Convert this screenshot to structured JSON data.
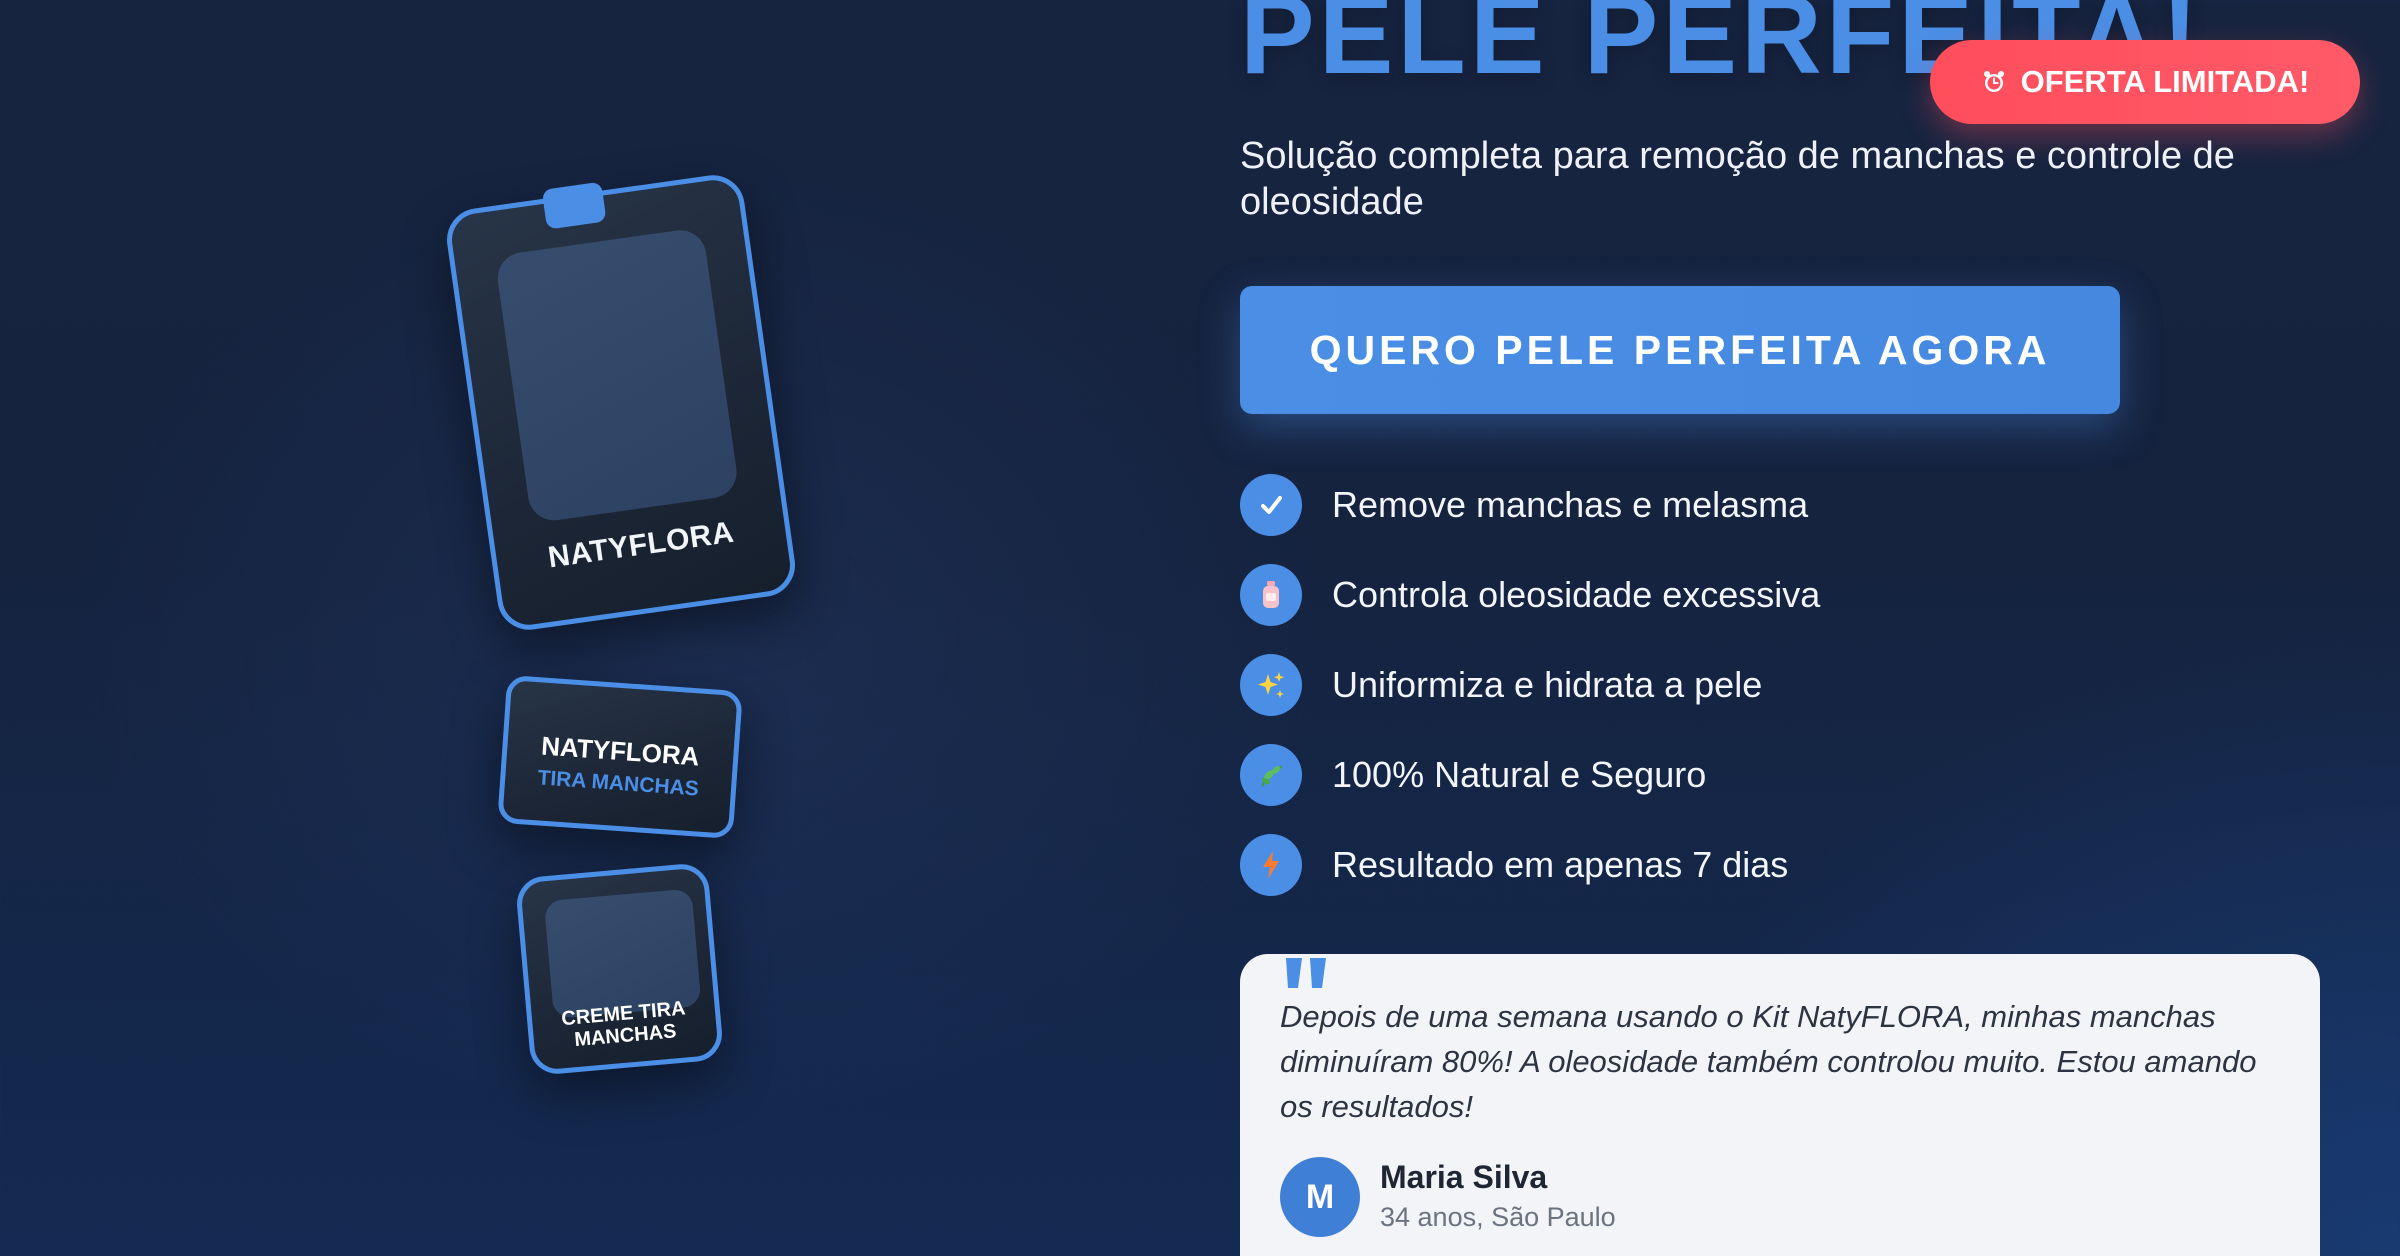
{
  "headline": "PELE PERFEITA!",
  "badge": {
    "label": "OFERTA LIMITADA!",
    "icon": "alarm-clock-icon"
  },
  "subtitle": "Solução completa para remoção de manchas e controle de oleosidade",
  "cta": {
    "label": "QUERO PELE PERFEITA AGORA"
  },
  "products": {
    "main_label": "NATYFLORA",
    "box_brand": "NATYFLORA",
    "box_subtitle": "TIRA MANCHAS",
    "jar_label": "CREME TIRA MANCHAS"
  },
  "benefits": [
    {
      "icon": "check-icon",
      "text": "Remove manchas e melasma"
    },
    {
      "icon": "bottle-icon",
      "text": "Controla oleosidade excessiva"
    },
    {
      "icon": "sparkles-icon",
      "text": "Uniformiza e hidrata a pele"
    },
    {
      "icon": "herb-icon",
      "text": "100% Natural e Seguro"
    },
    {
      "icon": "lightning-icon",
      "text": "Resultado em apenas 7 dias"
    }
  ],
  "testimonial": {
    "quote": "Depois de uma semana usando o Kit NatyFLORA, minhas manchas diminuíram 80%! A oleosidade também controlou muito. Estou amando os resultados!",
    "avatar_initial": "M",
    "name": "Maria Silva",
    "meta": "34 anos, São Paulo"
  },
  "colors": {
    "accent": "#4a8ee6",
    "badge": "#ff4d5c",
    "background": "#172440",
    "card": "#f3f4f7"
  }
}
